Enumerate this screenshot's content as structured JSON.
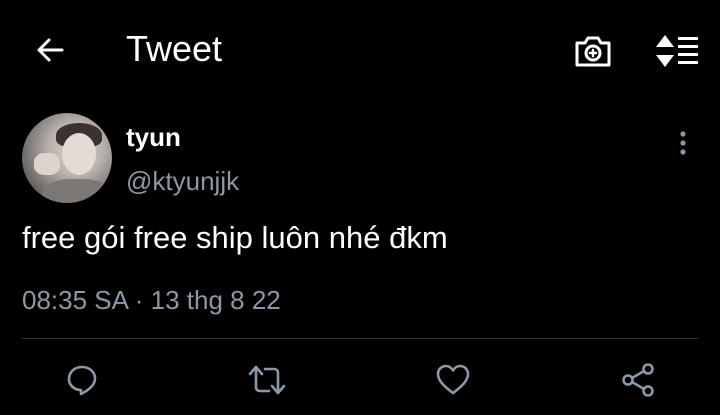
{
  "header": {
    "title": "Tweet",
    "back_icon": "arrow-left-icon",
    "camera_icon": "camera-icon",
    "sort_icon": "sort-icon"
  },
  "tweet": {
    "display_name": "tyun",
    "handle": "@ktyunjjk",
    "text": "free gói free ship luôn nhé đkm",
    "timestamp": "08:35 SA · 13 thg 8 22"
  },
  "actions": [
    {
      "name": "reply",
      "icon": "reply-icon"
    },
    {
      "name": "retweet",
      "icon": "retweet-icon"
    },
    {
      "name": "like",
      "icon": "heart-icon"
    },
    {
      "name": "share",
      "icon": "share-icon"
    }
  ],
  "colors": {
    "background": "#000000",
    "primary_text": "#ffffff",
    "secondary_text": "#8b98a5",
    "divider": "#2f3336"
  }
}
